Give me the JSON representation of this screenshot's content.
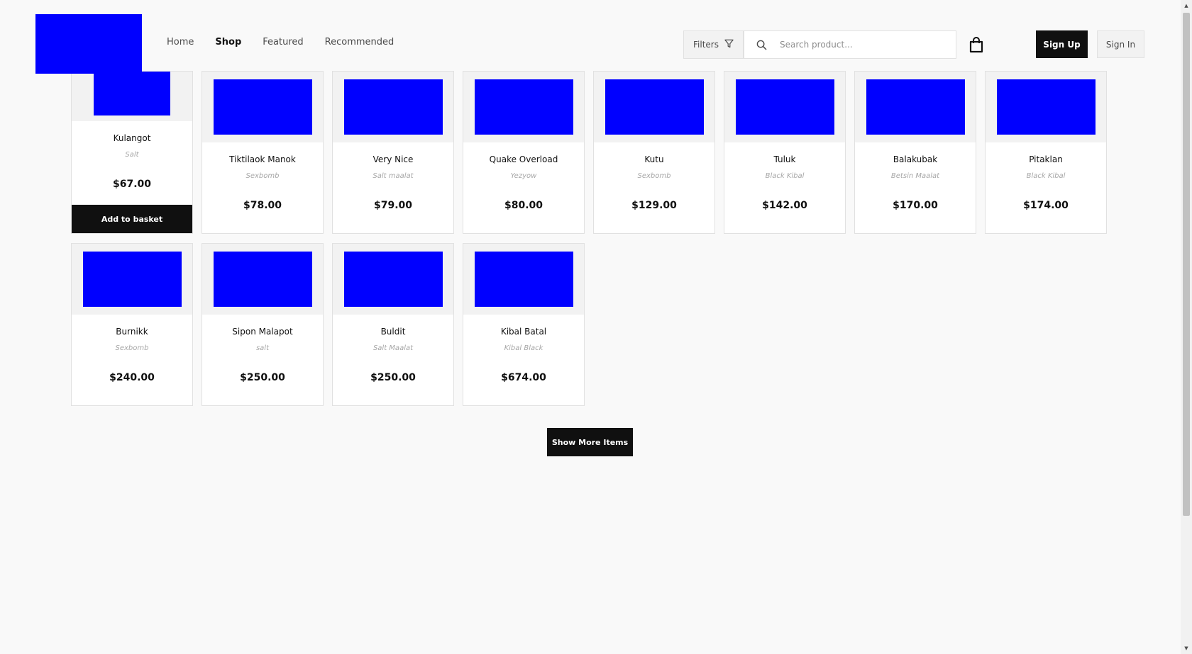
{
  "nav": {
    "items": [
      {
        "label": "Home",
        "active": false
      },
      {
        "label": "Shop",
        "active": true
      },
      {
        "label": "Featured",
        "active": false
      },
      {
        "label": "Recommended",
        "active": false
      }
    ]
  },
  "toolbar": {
    "filters_label": "Filters",
    "search_placeholder": "Search product...",
    "signup_label": "Sign Up",
    "signin_label": "Sign In"
  },
  "products": [
    {
      "name": "Kulangot",
      "brand": "Salt",
      "price": "$67.00",
      "action": "Add to basket"
    },
    {
      "name": "Tiktilaok Manok",
      "brand": "Sexbomb",
      "price": "$78.00"
    },
    {
      "name": "Very Nice",
      "brand": "Salt maalat",
      "price": "$79.00"
    },
    {
      "name": "Quake Overload",
      "brand": "Yezyow",
      "price": "$80.00"
    },
    {
      "name": "Kutu",
      "brand": "Sexbomb",
      "price": "$129.00"
    },
    {
      "name": "Tuluk",
      "brand": "Black Kibal",
      "price": "$142.00"
    },
    {
      "name": "Balakubak",
      "brand": "Betsin Maalat",
      "price": "$170.00"
    },
    {
      "name": "Pitaklan",
      "brand": "Black Kibal",
      "price": "$174.00"
    },
    {
      "name": "Burnikk",
      "brand": "Sexbomb",
      "price": "$240.00"
    },
    {
      "name": "Sipon Malapot",
      "brand": "salt",
      "price": "$250.00"
    },
    {
      "name": "Buldit",
      "brand": "Salt Maalat",
      "price": "$250.00"
    },
    {
      "name": "Kibal Batal",
      "brand": "Kibal Black",
      "price": "$674.00"
    }
  ],
  "show_more_label": "Show More Items",
  "colors": {
    "accent": "#0000ff",
    "dark": "#101010",
    "background": "#f9f9f9"
  }
}
